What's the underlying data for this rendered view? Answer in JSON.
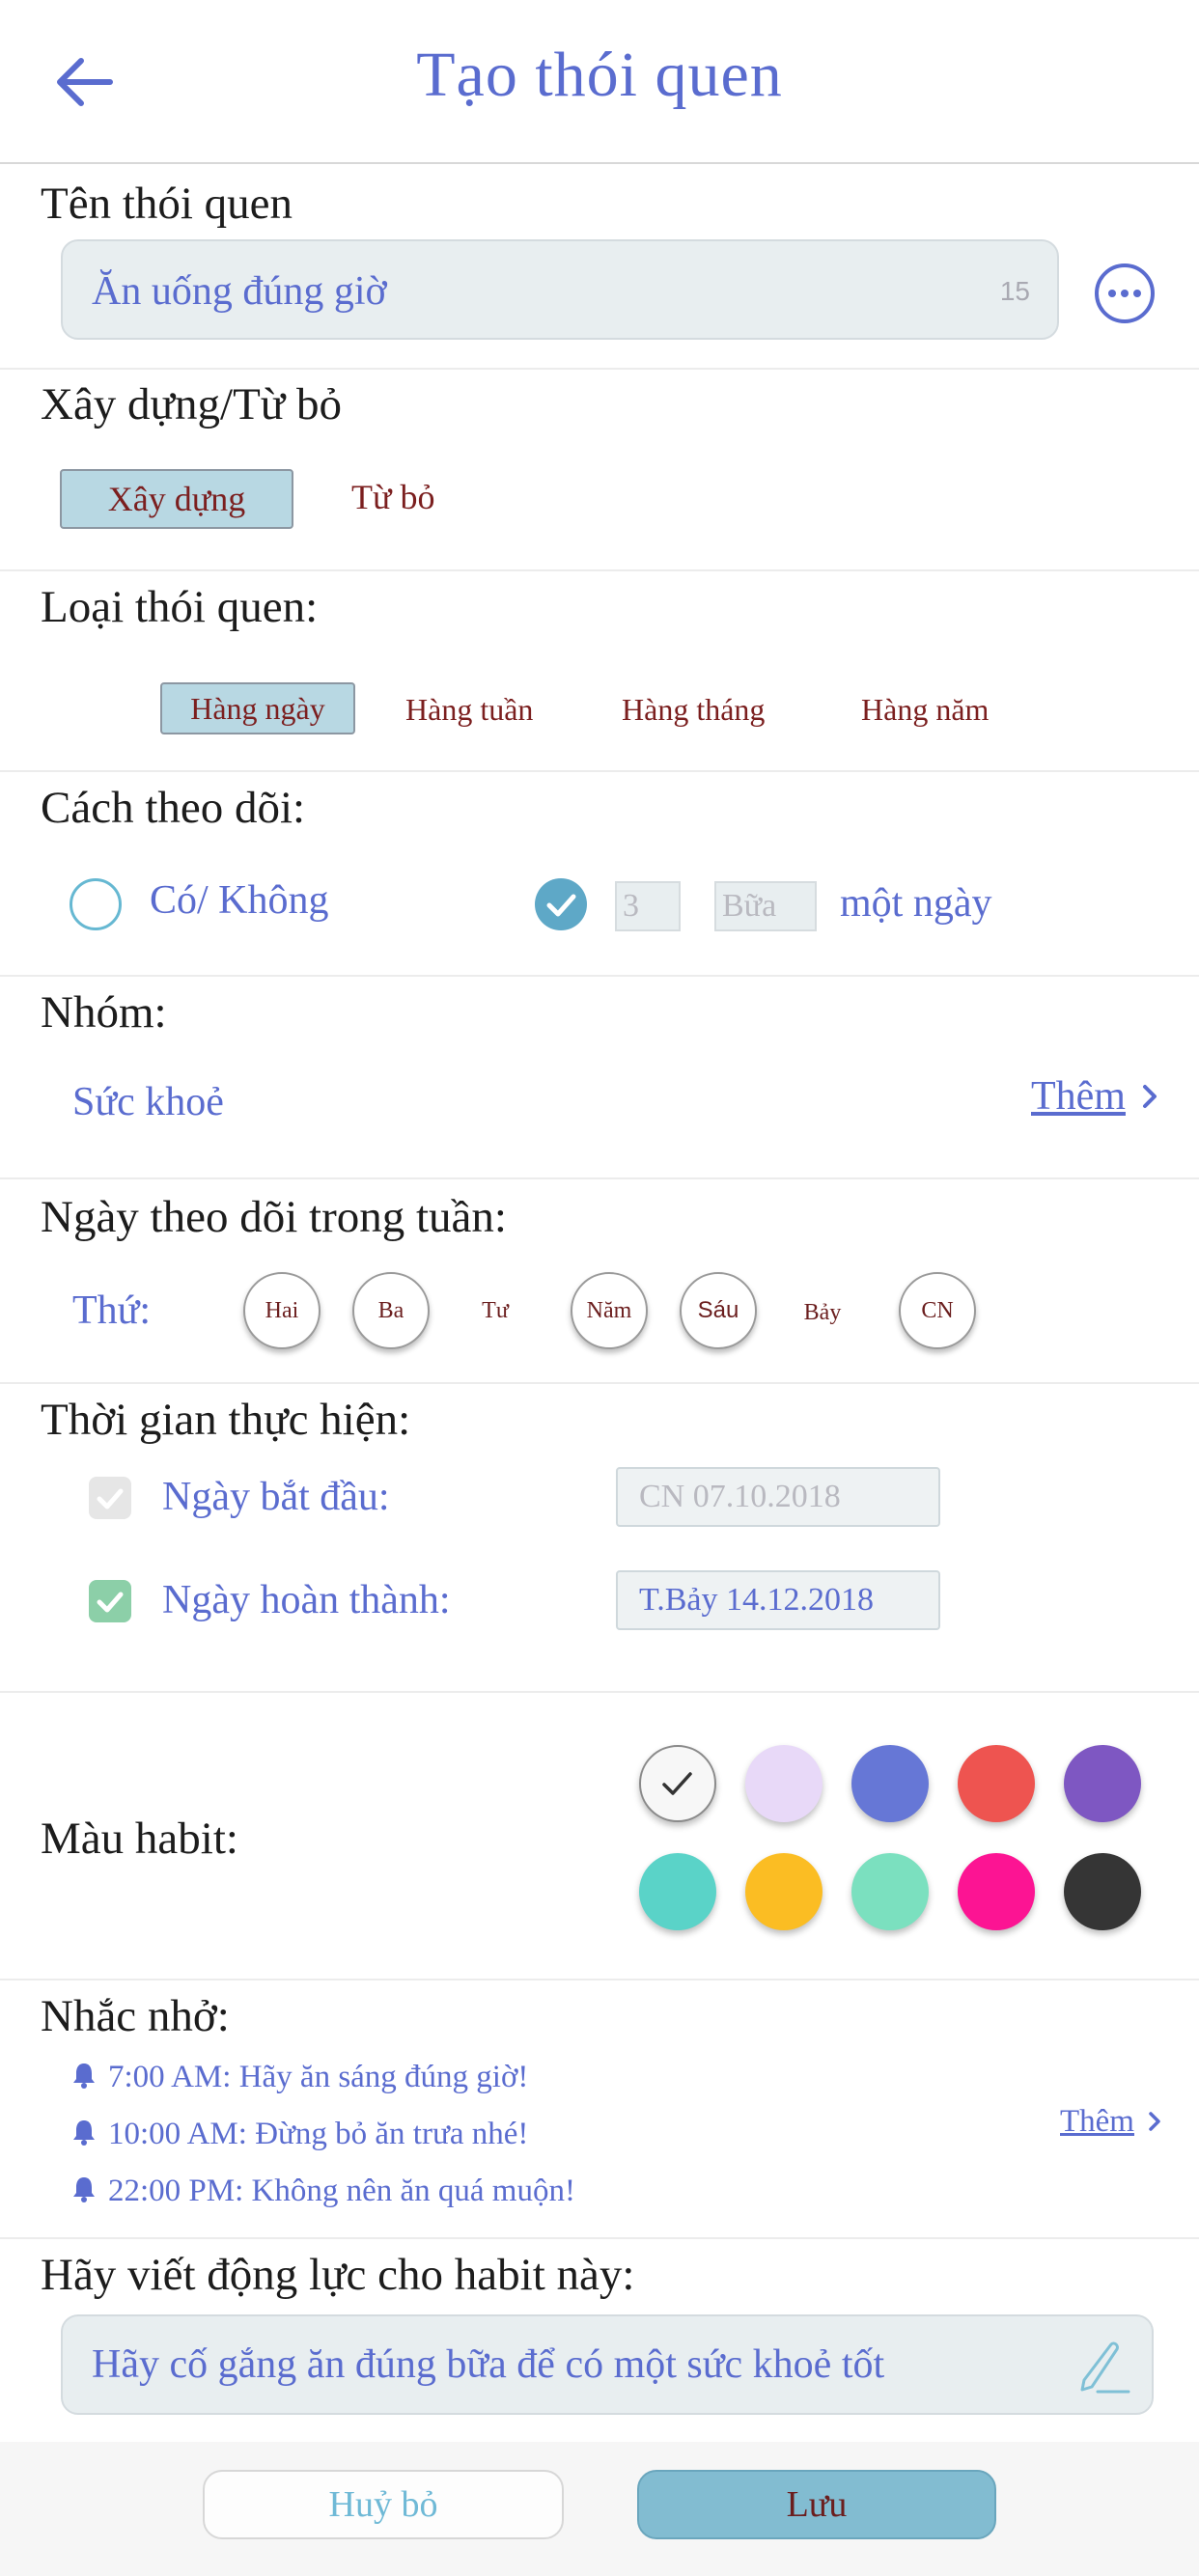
{
  "header": {
    "title": "Tạo thói quen",
    "back_icon": "arrow-left-icon"
  },
  "name_section": {
    "title": "Tên thói quen",
    "value": "Ăn uống đúng giờ",
    "char_count": "15",
    "menu_icon": "more-dots-icon"
  },
  "build_quit": {
    "title": "Xây dựng/Từ bỏ",
    "options": [
      "Xây dựng",
      "Từ bỏ"
    ],
    "selected": "Xây dựng"
  },
  "habit_type": {
    "title": "Loại thói quen:",
    "options": [
      "Hàng ngày",
      "Hàng tuần",
      "Hàng tháng",
      "Hàng năm"
    ],
    "selected": "Hàng ngày"
  },
  "tracking": {
    "title": "Cách theo dõi:",
    "yes_no_label": "Có/ Không",
    "count_value": "3",
    "unit_value": "Bữa",
    "per_label": "một ngày",
    "selected": "count"
  },
  "group": {
    "title": "Nhóm:",
    "value": "Sức khoẻ",
    "add_label": "Thêm"
  },
  "weekdays": {
    "title": "Ngày theo dõi trong tuần:",
    "label": "Thứ:",
    "days": [
      {
        "label": "Hai",
        "selected": true
      },
      {
        "label": "Ba",
        "selected": true
      },
      {
        "label": "Tư",
        "selected": false
      },
      {
        "label": "Năm",
        "selected": true
      },
      {
        "label": "Sáu",
        "selected": true
      },
      {
        "label": "Bảy",
        "selected": false
      },
      {
        "label": "CN",
        "selected": true
      }
    ]
  },
  "duration": {
    "title": "Thời gian thực hiện:",
    "start_label": "Ngày bắt đầu:",
    "start_value": "CN 07.10.2018",
    "start_checked": true,
    "end_label": "Ngày hoàn thành:",
    "end_value": "T.Bảy 14.12.2018",
    "end_checked": true
  },
  "color": {
    "title": "Màu habit:",
    "selected_index": 0,
    "swatches": [
      "#ffffff",
      "#e8d9f8",
      "#6677d6",
      "#ee5450",
      "#7e57c2",
      "#5ad3c8",
      "#fbbd23",
      "#7be0bf",
      "#fc1493",
      "#353535"
    ]
  },
  "reminders": {
    "title": "Nhắc nhở:",
    "items": [
      "7:00 AM: Hãy ăn sáng đúng giờ!",
      "10:00 AM: Đừng bỏ ăn trưa nhé!",
      "22:00 PM: Không nên ăn quá muộn!"
    ],
    "add_label": "Thêm",
    "icon": "bell-icon"
  },
  "motivation": {
    "title": "Hãy viết động lực cho habit này:",
    "value": "Hãy cố gắng ăn đúng bữa để có một sức khoẻ tốt",
    "edit_icon": "pen-icon"
  },
  "footer": {
    "cancel_label": "Huỷ bỏ",
    "save_label": "Lưu"
  },
  "colors": {
    "accent": "#5a6ccf",
    "selected_fill": "#b8d8e3",
    "label_maroon": "#7b1f1f",
    "save_button": "#82bcd1"
  }
}
